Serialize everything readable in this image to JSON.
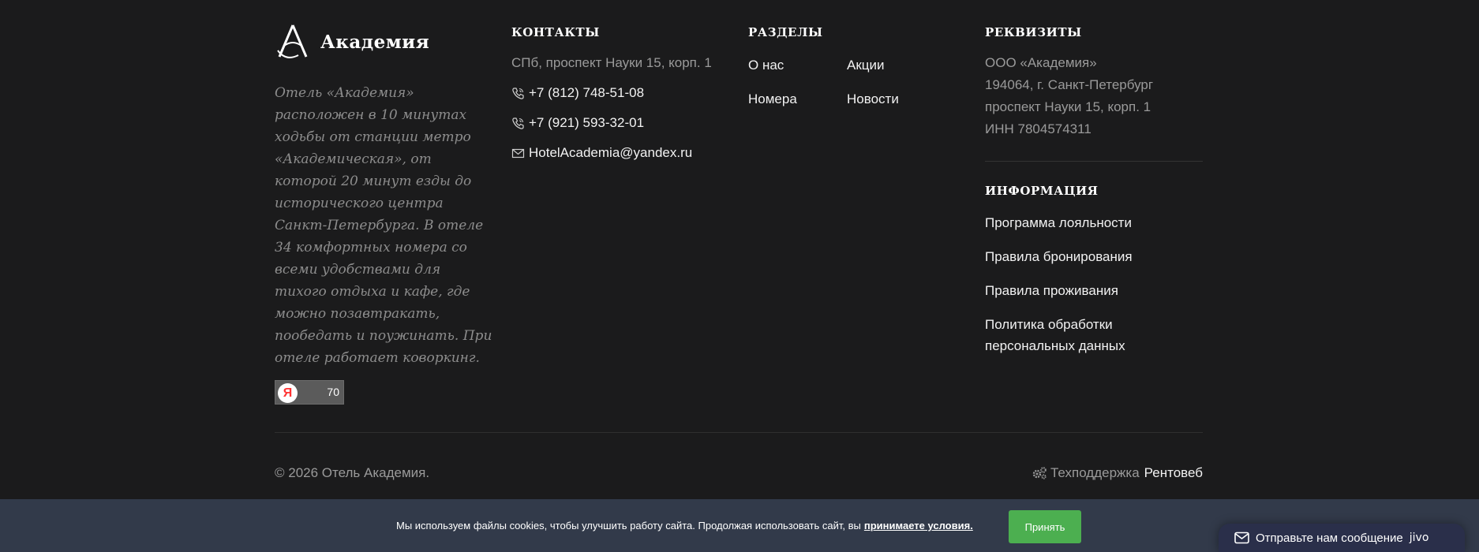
{
  "brand": {
    "name": "Академия"
  },
  "about": "Отель «Академия» расположен в 10 минутах ходьбы от станции метро «Академическая», от которой 20 минут езды до исторического центра Санкт-Петербурга. В отеле 34 комфортных номера со всеми удобствами для тихого отдыха и кафе, где можно позавтракать, пообедать и поужинать. При отеле работает коворкинг.",
  "rating_badge": {
    "logo": "Я",
    "value": "70"
  },
  "contacts": {
    "title": "КОНТАКТЫ",
    "address": "СПб, проспект Науки 15, корп. 1",
    "phone1": "+7 (812) 748-51-08",
    "phone2": "+7 (921) 593-32-01",
    "email": "HotelAcademia@yandex.ru"
  },
  "sections": {
    "title": "РАЗДЕЛЫ",
    "items": [
      "О нас",
      "Акции",
      "Номера",
      "Новости"
    ]
  },
  "requisites": {
    "title": "РЕКВИЗИТЫ",
    "lines": [
      "ООО «Академия»",
      "194064, г. Санкт-Петербург",
      "проспект Науки 15, корп. 1",
      "ИНН 7804574311"
    ]
  },
  "information": {
    "title": "ИНФОРМАЦИЯ",
    "links": [
      "Программа лояльности",
      "Правила бронирования",
      "Правила проживания",
      "Политика обработки персональных данных"
    ]
  },
  "bottom": {
    "copyright": "© 2026 Отель Академия.",
    "support_label": "Техподдержка",
    "support_brand": "Рентовеб"
  },
  "cookie": {
    "text": "Мы используем файлы cookies, чтобы улучшить работу сайта. Продолжая использовать сайт, вы",
    "link": "принимаете условия.",
    "accept": "Принять"
  },
  "chat": {
    "label": "Отправьте нам сообщение",
    "brand": "jivo"
  },
  "colors": {
    "background": "#1b1b1c",
    "cookie_bar": "#323a4a",
    "accept_button": "#4caf50",
    "chat_widget": "#2a2f4a"
  }
}
